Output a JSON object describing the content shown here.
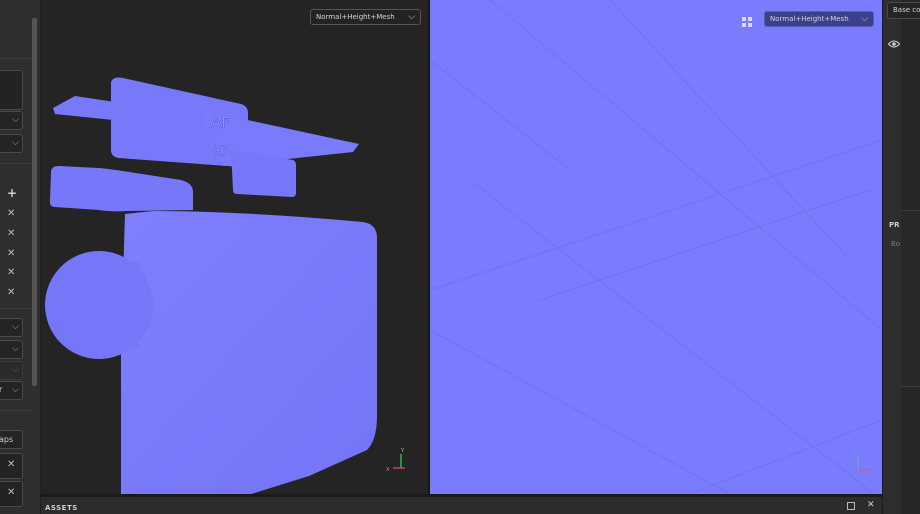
{
  "viewport_3d": {
    "display_mode": "Normal+Height+Mesh",
    "mesh_labels": [
      "AF",
      "Ю"
    ],
    "axis_labels": {
      "x": "X",
      "y": "Y"
    }
  },
  "viewport_2d": {
    "display_mode": "Normal+Height+Mesh"
  },
  "left_panel": {
    "add_icon": "+",
    "remove_icon": "✕",
    "partial_text_1": "r",
    "partial_text_2": "aps"
  },
  "right_panel": {
    "base_color_label": "Base co",
    "properties_label": "PR",
    "sub_label": "Bo"
  },
  "assets_bar": {
    "title": "ASSETS"
  },
  "colors": {
    "normal_map_blue": "#7b7bfd",
    "viewport_bg": "#242424",
    "panel_bg": "#2e2e2e"
  }
}
